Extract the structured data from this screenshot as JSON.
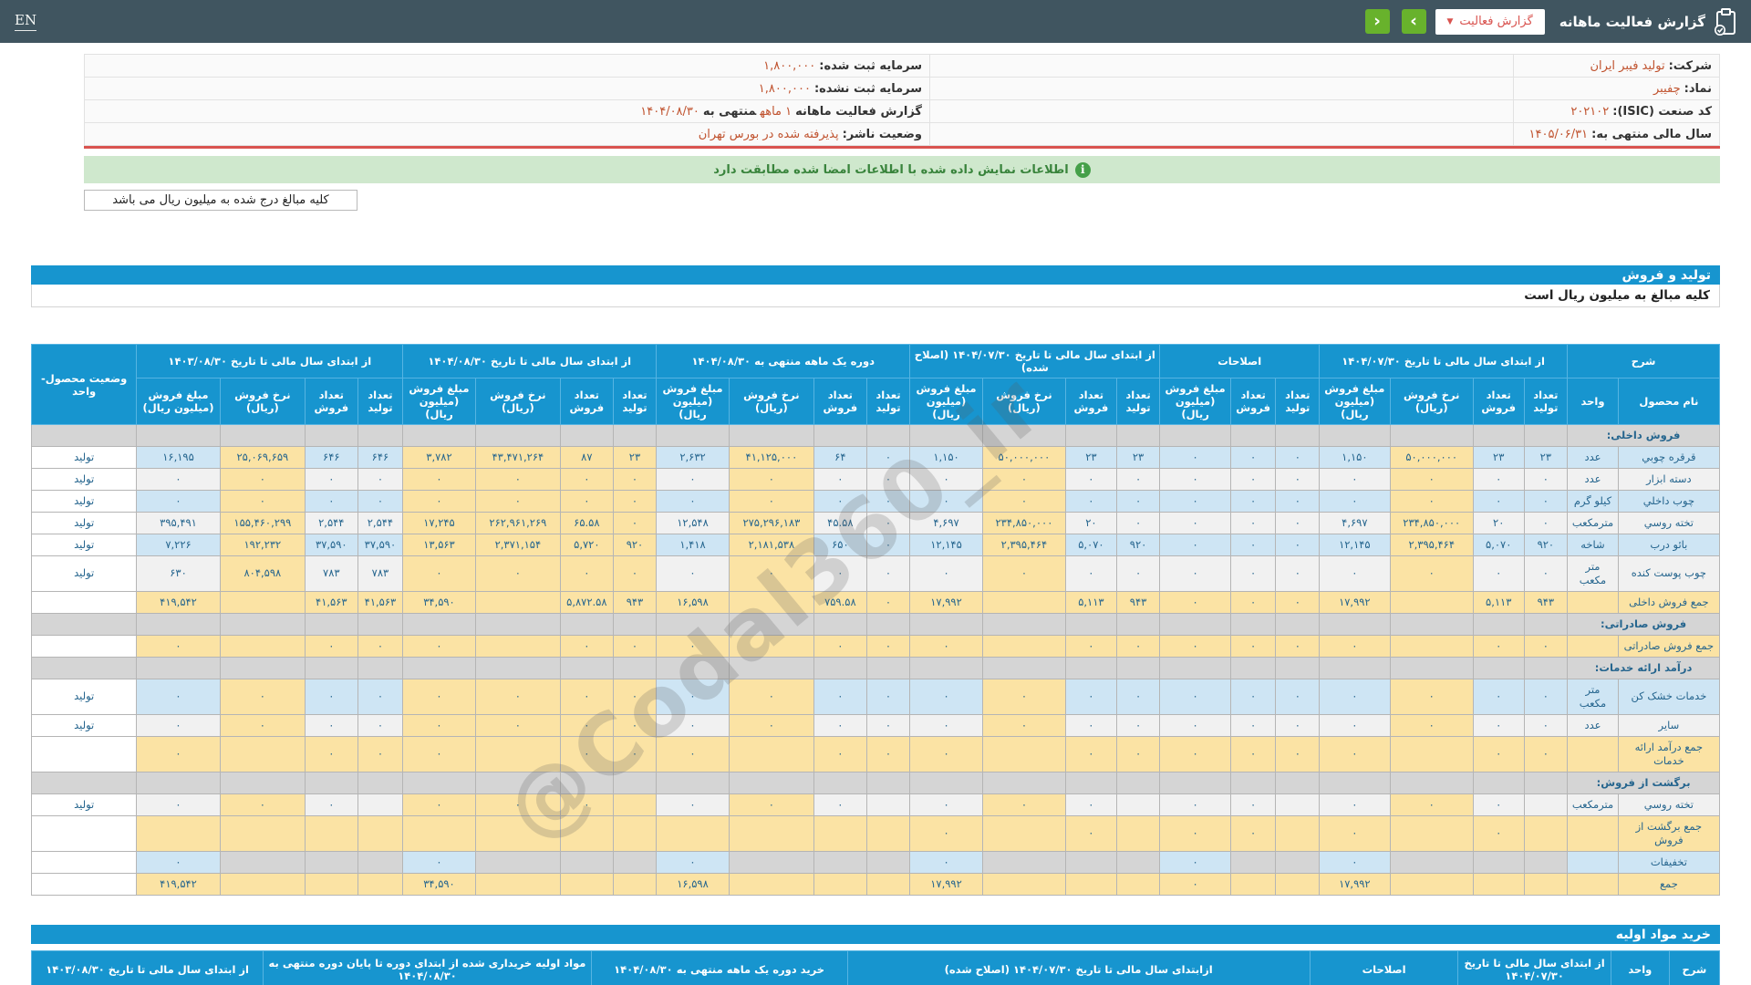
{
  "topbar": {
    "en": "EN",
    "title": "گزارش فعالیت ماهانه",
    "dropdown_label": "گزارش فعالیت",
    "prev": "‹",
    "next": "›"
  },
  "info": {
    "company_rows": [
      {
        "label": "شرکت:",
        "value": "تولید فیبر ایران"
      },
      {
        "label": "نماد:",
        "value": "چفیبر"
      },
      {
        "label": "کد صنعت (ISIC):",
        "value": "۲۰۲۱۰۲"
      },
      {
        "label": "سال مالی منتهی به:",
        "value": "۱۴۰۵/۰۶/۳۱"
      }
    ],
    "capital_rows": [
      {
        "label": "سرمایه ثبت شده:",
        "value": "۱,۸۰۰,۰۰۰"
      },
      {
        "label": "سرمایه ثبت نشده:",
        "value": "۱,۸۰۰,۰۰۰"
      },
      {
        "label": "گزارش فعالیت ماهانه",
        "value": "۱ ماهه",
        "label2": "منتهی به",
        "value2": "۱۴۰۴/۰۸/۳۰"
      },
      {
        "label": "وضعیت ناشر:",
        "value": "پذیرفته شده در بورس تهران"
      }
    ]
  },
  "notice": {
    "text": "اطلاعات نمایش داده شده با اطلاعات امضا شده مطابقت دارد",
    "icon": "i"
  },
  "notes": {
    "unit_note": "کلیه مبالغ درج شده به میلیون ریال می باشد"
  },
  "section1": {
    "title": "تولید و فروش",
    "subtitle": "کلیه مبالغ به میلیون ریال است"
  },
  "watermark": "@Codal360_ir",
  "table": {
    "groups": [
      {
        "label": "شرح",
        "cols": [
          "نام محصول",
          "واحد"
        ]
      },
      {
        "label": "از ابتدای سال مالی تا تاریخ ۱۴۰۴/۰۷/۳۰",
        "cols": [
          "تعداد تولید",
          "تعداد فروش",
          "نرخ فروش (ریال)",
          "مبلغ فروش (میلیون ریال)"
        ]
      },
      {
        "label": "اصلاحات",
        "cols": [
          "تعداد تولید",
          "تعداد فروش",
          "مبلغ فروش (میلیون ریال)"
        ]
      },
      {
        "label": "از ابتدای سال مالی تا تاریخ ۱۴۰۴/۰۷/۳۰ (اصلاح شده)",
        "cols": [
          "تعداد تولید",
          "تعداد فروش",
          "نرخ فروش (ریال)",
          "مبلغ فروش (میلیون ریال)"
        ]
      },
      {
        "label": "دوره یک ماهه منتهی به ۱۴۰۴/۰۸/۳۰",
        "cols": [
          "تعداد تولید",
          "تعداد فروش",
          "نرخ فروش (ریال)",
          "مبلغ فروش (میلیون ریال)"
        ]
      },
      {
        "label": "از ابتدای سال مالی تا تاریخ ۱۴۰۴/۰۸/۳۰",
        "cols": [
          "تعداد تولید",
          "تعداد فروش",
          "نرخ فروش (ریال)",
          "مبلغ فروش (میلیون ریال)"
        ]
      },
      {
        "label": "از ابتدای سال مالی تا تاریخ ۱۴۰۳/۰۸/۳۰",
        "cols": [
          "تعداد تولید",
          "تعداد فروش",
          "نرخ فروش (ریال)",
          "مبلغ فروش (میلیون ریال)"
        ]
      },
      {
        "label": "وضعیت محصول-واحد",
        "cols": []
      }
    ],
    "rows": [
      {
        "type": "section",
        "name": "فروش داخلی:"
      },
      {
        "type": "data",
        "stripe": "blue",
        "name": "قرقره چوبي",
        "unit": "عدد",
        "status": "تولید",
        "cells": [
          "۲۳",
          "۲۳",
          "۵۰,۰۰۰,۰۰۰",
          "۱,۱۵۰",
          "۰",
          "۰",
          "۰",
          "۲۳",
          "۲۳",
          "۵۰,۰۰۰,۰۰۰",
          "۱,۱۵۰",
          "۰",
          "۶۴",
          "۴۱,۱۲۵,۰۰۰",
          "۲,۶۳۲",
          "۲۳",
          "۸۷",
          "۴۳,۴۷۱,۲۶۴",
          "۳,۷۸۲",
          "۶۴۶",
          "۶۴۶",
          "۲۵,۰۶۹,۶۵۹",
          "۱۶,۱۹۵"
        ]
      },
      {
        "type": "data",
        "stripe": "gray",
        "name": "دسته ابزار",
        "unit": "عدد",
        "status": "تولید",
        "cells": [
          "۰",
          "۰",
          "۰",
          "۰",
          "۰",
          "۰",
          "۰",
          "۰",
          "۰",
          "۰",
          "۰",
          "۰",
          "۰",
          "۰",
          "۰",
          "۰",
          "۰",
          "۰",
          "۰",
          "۰",
          "۰",
          "۰",
          "۰"
        ]
      },
      {
        "type": "data",
        "stripe": "blue",
        "name": "چوب داخلي",
        "unit": "کیلو گرم",
        "status": "تولید",
        "cells": [
          "۰",
          "۰",
          "۰",
          "۰",
          "۰",
          "۰",
          "۰",
          "۰",
          "۰",
          "۰",
          "۰",
          "۰",
          "۰",
          "۰",
          "۰",
          "۰",
          "۰",
          "۰",
          "۰",
          "۰",
          "۰",
          "۰",
          "۰"
        ]
      },
      {
        "type": "data",
        "stripe": "gray",
        "name": "تخته روسي",
        "unit": "مترمکعب",
        "status": "تولید",
        "cells": [
          "۰",
          "۲۰",
          "۲۳۴,۸۵۰,۰۰۰",
          "۴,۶۹۷",
          "۰",
          "۰",
          "۰",
          "۰",
          "۲۰",
          "۲۳۴,۸۵۰,۰۰۰",
          "۴,۶۹۷",
          "۰",
          "۴۵.۵۸",
          "۲۷۵,۲۹۶,۱۸۳",
          "۱۲,۵۴۸",
          "۰",
          "۶۵.۵۸",
          "۲۶۲,۹۶۱,۲۶۹",
          "۱۷,۲۴۵",
          "۲,۵۴۴",
          "۲,۵۴۴",
          "۱۵۵,۴۶۰,۲۹۹",
          "۳۹۵,۴۹۱"
        ]
      },
      {
        "type": "data",
        "stripe": "blue",
        "name": "بائو درب",
        "unit": "شاخه",
        "status": "تولید",
        "cells": [
          "۹۲۰",
          "۵,۰۷۰",
          "۲,۳۹۵,۴۶۴",
          "۱۲,۱۴۵",
          "۰",
          "۰",
          "۰",
          "۹۲۰",
          "۵,۰۷۰",
          "۲,۳۹۵,۴۶۴",
          "۱۲,۱۴۵",
          "۰",
          "۶۵۰",
          "۲,۱۸۱,۵۳۸",
          "۱,۴۱۸",
          "۹۲۰",
          "۵,۷۲۰",
          "۲,۳۷۱,۱۵۴",
          "۱۳,۵۶۳",
          "۳۷,۵۹۰",
          "۳۷,۵۹۰",
          "۱۹۲,۲۳۲",
          "۷,۲۲۶"
        ]
      },
      {
        "type": "data",
        "stripe": "gray",
        "name": "چوب پوست کنده",
        "unit": "متر مکعب",
        "status": "تولید",
        "cells": [
          "۰",
          "۰",
          "۰",
          "۰",
          "۰",
          "۰",
          "۰",
          "۰",
          "۰",
          "۰",
          "۰",
          "۰",
          "۰",
          "۰",
          "۰",
          "۰",
          "۰",
          "۰",
          "۰",
          "۷۸۳",
          "۷۸۳",
          "۸۰۴,۵۹۸",
          "۶۳۰"
        ]
      },
      {
        "type": "sum",
        "name": "جمع فروش داخلی",
        "unit": "",
        "status": "",
        "cells": [
          "۹۴۳",
          "۵,۱۱۳",
          "",
          "۱۷,۹۹۲",
          "۰",
          "۰",
          "۰",
          "۹۴۳",
          "۵,۱۱۳",
          "",
          "۱۷,۹۹۲",
          "۰",
          "۷۵۹.۵۸",
          "",
          "۱۶,۵۹۸",
          "۹۴۳",
          "۵,۸۷۲.۵۸",
          "",
          "۳۴,۵۹۰",
          "۴۱,۵۶۳",
          "۴۱,۵۶۳",
          "",
          "۴۱۹,۵۴۲"
        ]
      },
      {
        "type": "section",
        "name": "فروش صادراتی:"
      },
      {
        "type": "sum",
        "name": "جمع فروش صادراتی",
        "unit": "",
        "status": "",
        "cells": [
          "۰",
          "۰",
          "",
          "۰",
          "۰",
          "۰",
          "۰",
          "۰",
          "۰",
          "",
          "۰",
          "۰",
          "۰",
          "",
          "۰",
          "۰",
          "۰",
          "",
          "۰",
          "۰",
          "۰",
          "",
          "۰"
        ]
      },
      {
        "type": "section",
        "name": "درآمد ارائه خدمات:"
      },
      {
        "type": "data",
        "stripe": "blue",
        "name": "خدمات خشک کن",
        "unit": "متر مکعب",
        "status": "تولید",
        "cells": [
          "۰",
          "۰",
          "۰",
          "۰",
          "۰",
          "۰",
          "۰",
          "۰",
          "۰",
          "۰",
          "۰",
          "۰",
          "۰",
          "۰",
          "۰",
          "۰",
          "۰",
          "۰",
          "۰",
          "۰",
          "۰",
          "۰",
          "۰"
        ]
      },
      {
        "type": "data",
        "stripe": "gray",
        "name": "سایر",
        "unit": "عدد",
        "status": "تولید",
        "cells": [
          "۰",
          "۰",
          "۰",
          "۰",
          "۰",
          "۰",
          "۰",
          "۰",
          "۰",
          "۰",
          "۰",
          "۰",
          "۰",
          "۰",
          "۰",
          "۰",
          "۰",
          "۰",
          "۰",
          "۰",
          "۰",
          "۰",
          "۰"
        ]
      },
      {
        "type": "sum",
        "name": "جمع درآمد ارائه خدمات",
        "unit": "",
        "status": "",
        "cells": [
          "۰",
          "۰",
          "",
          "۰",
          "۰",
          "۰",
          "۰",
          "۰",
          "۰",
          "",
          "۰",
          "۰",
          "۰",
          "",
          "۰",
          "۰",
          "۰",
          "",
          "۰",
          "۰",
          "۰",
          "",
          "۰"
        ]
      },
      {
        "type": "section",
        "name": "برگشت از فروش:"
      },
      {
        "type": "data",
        "stripe": "gray",
        "name": "تخته روسي",
        "unit": "مترمکعب",
        "status": "تولید",
        "cells": [
          "",
          "۰",
          "۰",
          "۰",
          "",
          "۰",
          "۰",
          "",
          "۰",
          "۰",
          "۰",
          "",
          "۰",
          "۰",
          "۰",
          "",
          "۰",
          "۰",
          "۰",
          "",
          "۰",
          "۰",
          "۰"
        ]
      },
      {
        "type": "sum",
        "name": "جمع برگشت از فروش",
        "unit": "",
        "status": "",
        "cells": [
          "",
          "۰",
          "",
          "۰",
          "",
          "۰",
          "۰",
          "",
          "۰",
          "",
          "۰",
          "",
          "",
          "",
          "",
          "",
          "",
          "",
          "",
          "",
          "",
          "",
          ""
        ]
      },
      {
        "type": "discount",
        "name": "تخفیفات",
        "unit": "",
        "status": "",
        "cells": [
          "",
          "",
          "",
          "۰",
          "",
          "",
          "۰",
          "",
          "",
          "",
          "۰",
          "",
          "",
          "",
          "۰",
          "",
          "",
          "",
          "۰",
          "",
          "",
          "",
          "۰"
        ]
      },
      {
        "type": "sum",
        "name": "جمع",
        "unit": "",
        "status": "",
        "cells": [
          "",
          "",
          "",
          "۱۷,۹۹۲",
          "",
          "",
          "۰",
          "",
          "",
          "",
          "۱۷,۹۹۲",
          "",
          "",
          "",
          "۱۶,۵۹۸",
          "",
          "",
          "",
          "۳۴,۵۹۰",
          "",
          "",
          "",
          "۴۱۹,۵۴۲"
        ]
      }
    ]
  },
  "purchase": {
    "title": "خرید مواد اولیه",
    "headers": [
      "شرح",
      "واحد",
      "از ابتدای سال مالی تا تاریخ ۱۴۰۴/۰۷/۳۰",
      "اصلاحات",
      "ازابتدای سال مالی تا تاریخ ۱۴۰۴/۰۷/۳۰ (اصلاح شده)",
      "خرید دوره یک ماهه منتهی به ۱۴۰۴/۰۸/۳۰",
      "مواد اولیه خریداری شده از ابتدای دوره تا پایان دوره منتهی به ۱۴۰۴/۰۸/۳۰",
      "از ابتدای سال مالی تا تاریخ ۱۴۰۳/۰۸/۳۰"
    ]
  }
}
